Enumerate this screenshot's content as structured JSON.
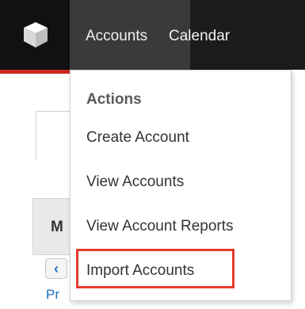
{
  "nav": {
    "logo_icon": "cube-logo-icon",
    "tabs": [
      "Accounts",
      "Calendar"
    ],
    "accent_color": "#c8291f"
  },
  "menu": {
    "heading": "Actions",
    "items": [
      "Create Account",
      "View Accounts",
      "View Account Reports",
      "Import Accounts"
    ],
    "highlighted_item": "Import Accounts",
    "highlight_color": "#e83a2c"
  },
  "background": {
    "partial_header_text": "M",
    "partial_link_text": "Pr",
    "back_icon": "chevron-left-icon"
  }
}
